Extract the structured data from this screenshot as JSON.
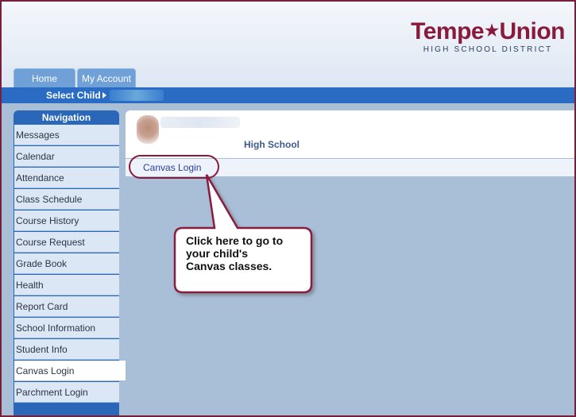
{
  "logo": {
    "main_left": "Tempe",
    "star": "★",
    "main_right": "Union",
    "sub": "HIGH SCHOOL DISTRICT"
  },
  "tabs": [
    {
      "label": "Home"
    },
    {
      "label": "My Account"
    }
  ],
  "childbar": {
    "label": "Select Child"
  },
  "navigation": {
    "heading": "Navigation",
    "items": [
      {
        "label": "Messages"
      },
      {
        "label": "Calendar"
      },
      {
        "label": "Attendance"
      },
      {
        "label": "Class Schedule"
      },
      {
        "label": "Course History"
      },
      {
        "label": "Course Request"
      },
      {
        "label": "Grade Book"
      },
      {
        "label": "Health"
      },
      {
        "label": "Report Card"
      },
      {
        "label": "School Information"
      },
      {
        "label": "Student Info"
      },
      {
        "label": "Canvas Login",
        "active": true
      },
      {
        "label": "Parchment Login"
      }
    ]
  },
  "student": {
    "school": "High School"
  },
  "links": {
    "canvas_login": "Canvas Login"
  },
  "callout": {
    "line1": "Click here to go to",
    "line2": "your child's",
    "line3": "Canvas classes."
  },
  "colors": {
    "brand": "#8a1a3c",
    "nav_blue": "#2a67b8",
    "bar_blue": "#2a6cc4",
    "content_bg": "#a9bfd8"
  }
}
